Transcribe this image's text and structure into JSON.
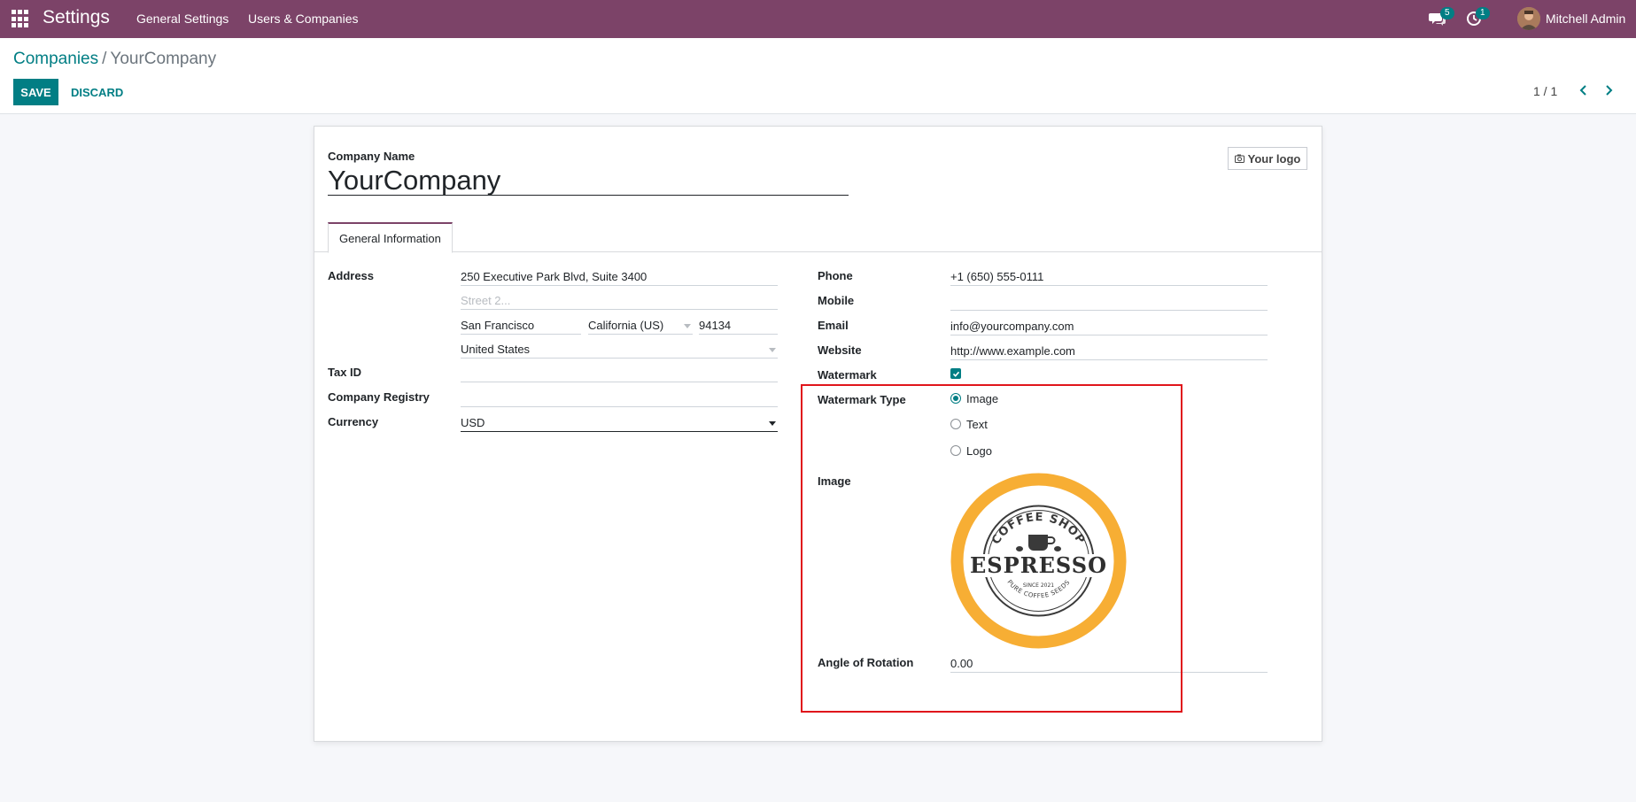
{
  "navbar": {
    "app_title": "Settings",
    "menu": [
      "General Settings",
      "Users & Companies"
    ],
    "messages_count": "5",
    "activities_count": "1",
    "user_name": "Mitchell Admin"
  },
  "breadcrumb": {
    "parent": "Companies",
    "separator": "/",
    "current": "YourCompany"
  },
  "buttons": {
    "save": "SAVE",
    "discard": "DISCARD"
  },
  "pager": "1 / 1",
  "form": {
    "company_name_label": "Company Name",
    "company_name": "YourCompany",
    "logo_button": "Your logo",
    "tab": "General Information",
    "left": {
      "address_label": "Address",
      "street": "250 Executive Park Blvd, Suite 3400",
      "street2_placeholder": "Street 2...",
      "city": "San Francisco",
      "state": "California (US)",
      "zip": "94134",
      "country": "United States",
      "tax_id_label": "Tax ID",
      "tax_id": "",
      "company_registry_label": "Company Registry",
      "company_registry": "",
      "currency_label": "Currency",
      "currency": "USD"
    },
    "right": {
      "phone_label": "Phone",
      "phone": "+1 (650) 555-0111",
      "mobile_label": "Mobile",
      "mobile": "",
      "email_label": "Email",
      "email": "info@yourcompany.com",
      "website_label": "Website",
      "website": "http://www.example.com",
      "watermark_label": "Watermark",
      "watermark_checked": true,
      "watermark_type_label": "Watermark Type",
      "watermark_types": [
        "Image",
        "Text",
        "Logo"
      ],
      "watermark_type_selected": "Image",
      "image_label": "Image",
      "image_logo": {
        "arc_text": "COFFEE SHOP",
        "main_text": "ESPRESSO",
        "since_text": "SINCE 2021",
        "bottom_text": "PURE COFFEE SEEDS",
        "ring_color": "#f7ae34"
      },
      "angle_label": "Angle of Rotation",
      "angle": "0.00"
    }
  },
  "colors": {
    "navbar": "#7c4368",
    "primary": "#017e84",
    "highlight": "#e0151b"
  }
}
